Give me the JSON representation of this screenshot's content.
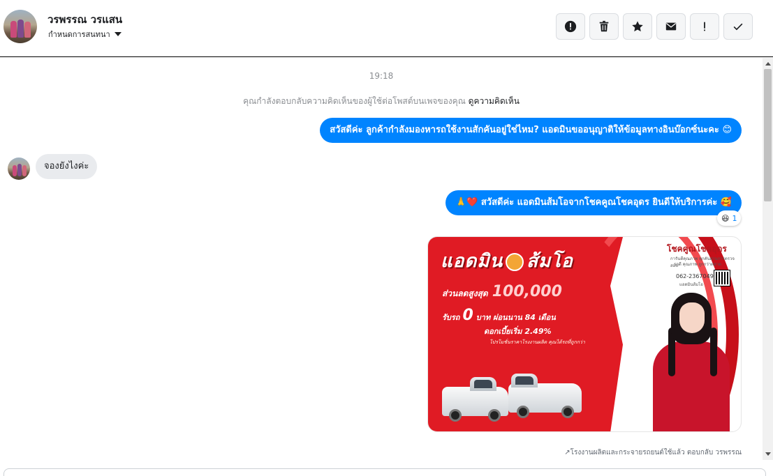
{
  "header": {
    "contact_name": "วรพรรณ วรแสน",
    "conversation_settings": "กำหนดการสนทนา",
    "actions": [
      {
        "name": "report-spam-button",
        "icon": "alert-circle-icon"
      },
      {
        "name": "delete-button",
        "icon": "trash-icon"
      },
      {
        "name": "star-button",
        "icon": "star-icon"
      },
      {
        "name": "mark-unread-button",
        "icon": "envelope-icon"
      },
      {
        "name": "important-button",
        "icon": "exclamation-icon"
      },
      {
        "name": "done-button",
        "icon": "check-icon"
      }
    ]
  },
  "chat": {
    "timestamp": "19:18",
    "context_text": "คุณกำลังตอบกลับความคิดเห็นของผู้ใช้ต่อโพสต์บนเพจของคุณ",
    "context_link": "ดูความคิดเห็น",
    "messages": [
      {
        "direction": "out",
        "text": "สวัสดีค่ะ ลูกค้ากำลังมองหารถใช้งานสักคันอยู่ใช่ไหม? แอดมินขออนุญาติให้ข้อมูลทางอินบ๊อกซ์นะคะ 😊"
      },
      {
        "direction": "in",
        "text": "จองยังไงค่ะ"
      },
      {
        "direction": "out",
        "text": "🙏❤️ สวัสดีค่ะ แอดมินส้มโอจากโชคคูณโชคอุดร ยินดีให้บริการค่ะ 🥰"
      }
    ],
    "reaction": {
      "emoji": "😆",
      "count": "1"
    },
    "promo": {
      "title_left": "แอดมิน",
      "title_right": "ส้มโอ",
      "discount_label": "ส่วนลดสูงสุด",
      "discount_value": "100,000",
      "down_label": "รับรถ",
      "down_value": "0",
      "down_rest": "บาท ผ่อนนาน 84 เดือน",
      "rate": "ดอกเบี้ยเริ่ม 2.49%",
      "small_note": "โปรโมชั่นราคาโรงงานผลิต คุณได้รถที่ถูกกว่า",
      "brand": "โชคคูณโชคอุดร",
      "brand_sub1": "การันตีคุณภาพ ทุกคันผ่านการตรวจสอบ",
      "brand_sub2": "รถดี คุณภาพ ถูกกว่าตลาด",
      "phone": "062-2367049",
      "admin_label": "แอดมินส้มโอ"
    },
    "source_text": "โรงงานผลิตและกระจายรถยนต์ใช้แล้ว ตอบกลับ วรพรรณ"
  },
  "colors": {
    "accent": "#0084ff",
    "incoming_bubble": "#e9ebee",
    "promo_red": "#e01b24"
  }
}
